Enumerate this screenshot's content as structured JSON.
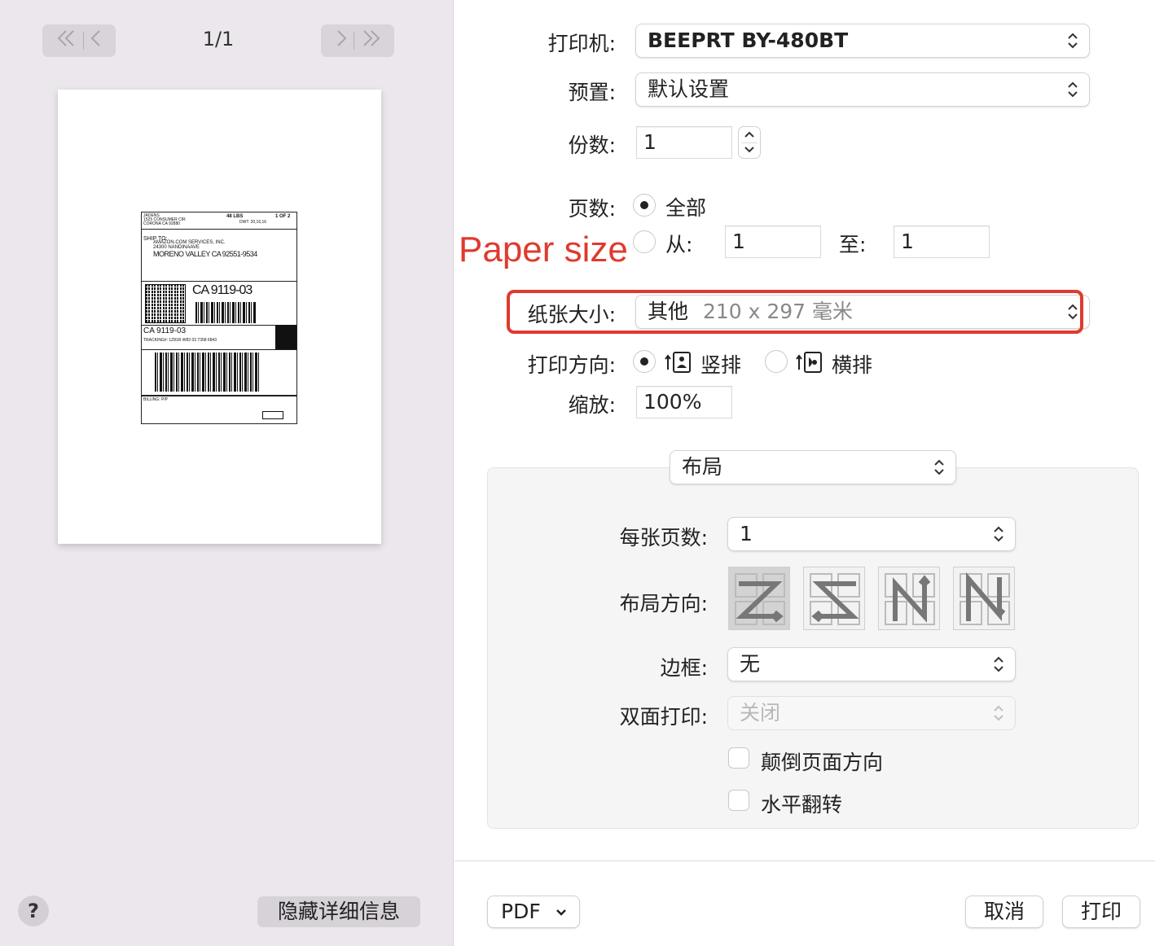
{
  "preview": {
    "page_counter": "1/1",
    "label": {
      "sender_name": "JADENS",
      "sender_addr1": "1525 CONSUMER CIR",
      "sender_addr2": "CORONA CA 92880",
      "weight": "48 LBS",
      "page_of": "1 OF 2",
      "dwt": "DWT: 20,16,16",
      "ship_to": "SHIP TO:",
      "recipient_line1": "AMAZON.COM SERVICES, INC.",
      "recipient_line2": "24300 NANDINAAVE",
      "recipient_line3": "MORENO VALLEY CA 92551-9534",
      "route_code": "CA 9119-03",
      "route_code_small": "CA 9119-03",
      "tracking": "TRACKING#: 1Z81R W83 03 7358 6843",
      "billing": "BILLING: P/P"
    }
  },
  "footer_left": {
    "help_label": "?",
    "hide_details_label": "隐藏详细信息"
  },
  "printer": {
    "label": "打印机:",
    "value": "BEEPRT BY-480BT"
  },
  "presets": {
    "label": "预置:",
    "value": "默认设置"
  },
  "copies": {
    "label": "份数:",
    "value": "1"
  },
  "pages": {
    "label": "页数:",
    "all_label": "全部",
    "from_label": "从:",
    "from_value": "1",
    "to_label": "至:",
    "to_value": "1",
    "selected": "all"
  },
  "annotation": {
    "text": "Paper size",
    "color": "#e03a2e"
  },
  "paper_size": {
    "label": "纸张大小:",
    "value_main": "其他",
    "value_detail": "210 x 297 毫米"
  },
  "orientation": {
    "label": "打印方向:",
    "portrait_label": "竖排",
    "landscape_label": "横排",
    "selected": "portrait"
  },
  "scale": {
    "label": "缩放:",
    "value": "100%"
  },
  "section_menu": {
    "value": "布局"
  },
  "layout": {
    "pages_per_sheet": {
      "label": "每张页数:",
      "value": "1"
    },
    "layout_direction": {
      "label": "布局方向:",
      "options": [
        "z-right-down-icon",
        "z-left-down-icon",
        "n-down-right-icon",
        "n-down-left-icon"
      ],
      "selected_index": 0
    },
    "border": {
      "label": "边框:",
      "value": "无"
    },
    "two_sided": {
      "label": "双面打印:",
      "value": "关闭",
      "enabled": false
    },
    "reverse_orientation": {
      "label": "颠倒页面方向",
      "checked": false
    },
    "flip_horizontally": {
      "label": "水平翻转",
      "checked": false
    }
  },
  "footer_right": {
    "pdf_label": "PDF",
    "cancel_label": "取消",
    "print_label": "打印"
  }
}
